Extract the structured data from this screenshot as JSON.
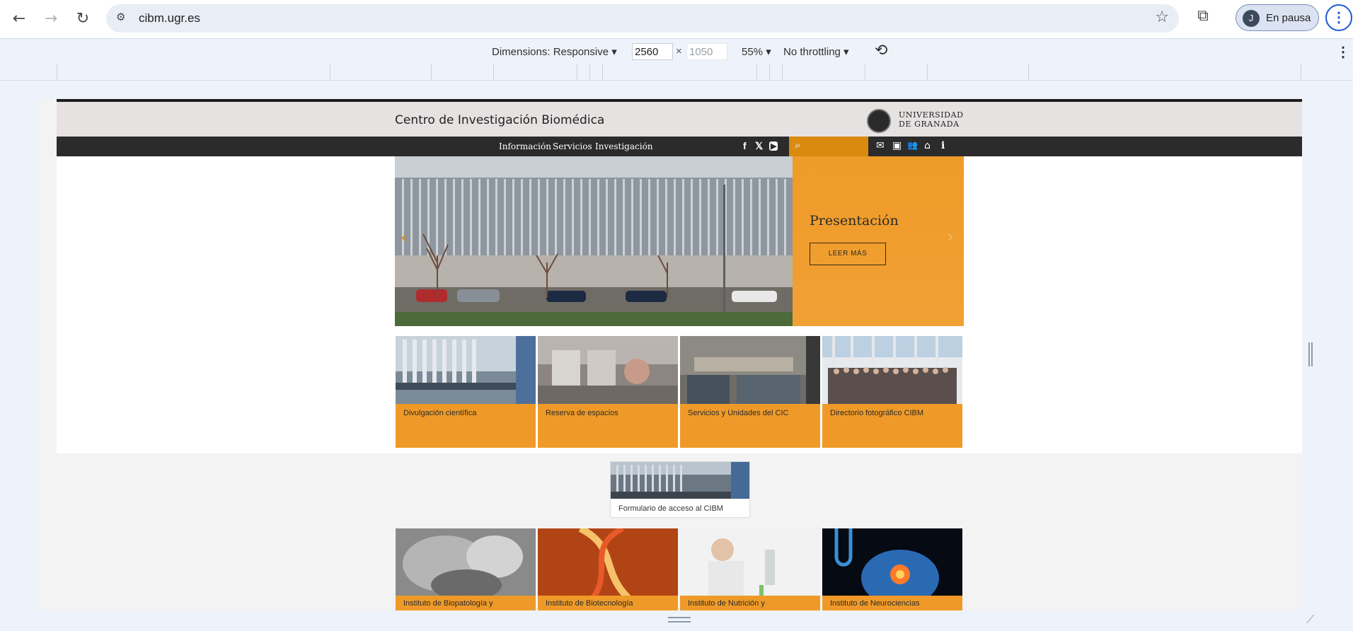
{
  "browser": {
    "url": "cibm.ugr.es",
    "profile_initial": "J",
    "profile_label": "En pausa",
    "back_icon": "arrow-left-icon",
    "forward_icon": "arrow-right-icon",
    "reload_icon": "reload-icon",
    "back_glyph": "←",
    "forward_glyph": "→",
    "reload_glyph": "↻",
    "site_info_glyph": "⚙",
    "star_glyph": "☆",
    "extensions_glyph": "⧉",
    "menu_glyph": "⋮"
  },
  "devtools": {
    "dimensions_label": "Dimensions: Responsive ▾",
    "width": "2560",
    "height": "1050",
    "times": "×",
    "zoom": "55% ▾",
    "throttling": "No throttling ▾",
    "rotate_glyph": "⟲",
    "more_glyph": "⋮"
  },
  "site": {
    "title": "Centro de Investigación Biomédica",
    "university_line1": "UNIVERSIDAD",
    "university_line2": "DE GRANADA",
    "menu": [
      "Información",
      "Servicios",
      "Investigación"
    ],
    "social": [
      "f",
      "𝕏",
      "▶"
    ],
    "search_glyph": "⌕",
    "tools": [
      "✉",
      "▣",
      "👥",
      "⌂",
      "i"
    ],
    "hero": {
      "title": "Presentación",
      "button": "LEER MÁS",
      "prev": "‹",
      "next": "›"
    },
    "cards": [
      "Divulgación científica",
      "Reserva de espacios",
      "Servicios y Unidades del CIC",
      "Directorio fotográfico CIBM"
    ],
    "form_card": "Formulario de acceso al CIBM",
    "institutes": [
      "Instituto de Biopatología y",
      "Instituto de Biotecnología",
      "Instituto de Nutrición y",
      "Instituto de Neurociencias"
    ]
  }
}
